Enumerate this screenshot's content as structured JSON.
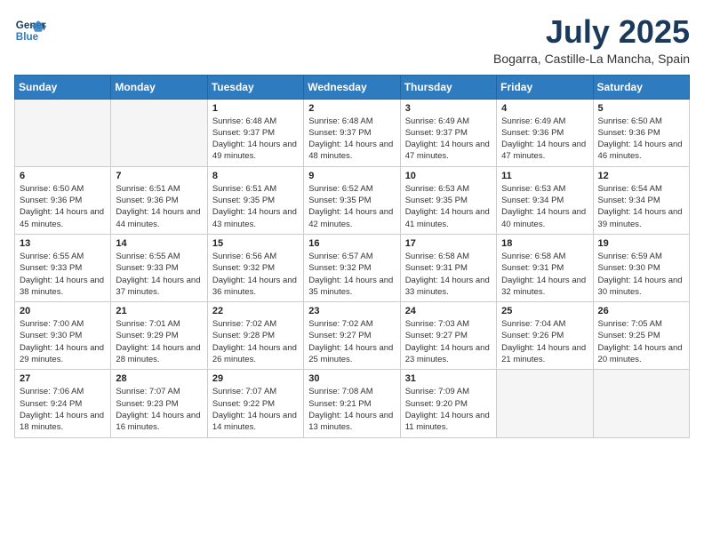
{
  "header": {
    "logo_line1": "General",
    "logo_line2": "Blue",
    "title": "July 2025",
    "subtitle": "Bogarra, Castille-La Mancha, Spain"
  },
  "columns": [
    "Sunday",
    "Monday",
    "Tuesday",
    "Wednesday",
    "Thursday",
    "Friday",
    "Saturday"
  ],
  "weeks": [
    {
      "days": [
        {
          "num": "",
          "detail": ""
        },
        {
          "num": "",
          "detail": ""
        },
        {
          "num": "1",
          "detail": "Sunrise: 6:48 AM\nSunset: 9:37 PM\nDaylight: 14 hours and 49 minutes."
        },
        {
          "num": "2",
          "detail": "Sunrise: 6:48 AM\nSunset: 9:37 PM\nDaylight: 14 hours and 48 minutes."
        },
        {
          "num": "3",
          "detail": "Sunrise: 6:49 AM\nSunset: 9:37 PM\nDaylight: 14 hours and 47 minutes."
        },
        {
          "num": "4",
          "detail": "Sunrise: 6:49 AM\nSunset: 9:36 PM\nDaylight: 14 hours and 47 minutes."
        },
        {
          "num": "5",
          "detail": "Sunrise: 6:50 AM\nSunset: 9:36 PM\nDaylight: 14 hours and 46 minutes."
        }
      ]
    },
    {
      "days": [
        {
          "num": "6",
          "detail": "Sunrise: 6:50 AM\nSunset: 9:36 PM\nDaylight: 14 hours and 45 minutes."
        },
        {
          "num": "7",
          "detail": "Sunrise: 6:51 AM\nSunset: 9:36 PM\nDaylight: 14 hours and 44 minutes."
        },
        {
          "num": "8",
          "detail": "Sunrise: 6:51 AM\nSunset: 9:35 PM\nDaylight: 14 hours and 43 minutes."
        },
        {
          "num": "9",
          "detail": "Sunrise: 6:52 AM\nSunset: 9:35 PM\nDaylight: 14 hours and 42 minutes."
        },
        {
          "num": "10",
          "detail": "Sunrise: 6:53 AM\nSunset: 9:35 PM\nDaylight: 14 hours and 41 minutes."
        },
        {
          "num": "11",
          "detail": "Sunrise: 6:53 AM\nSunset: 9:34 PM\nDaylight: 14 hours and 40 minutes."
        },
        {
          "num": "12",
          "detail": "Sunrise: 6:54 AM\nSunset: 9:34 PM\nDaylight: 14 hours and 39 minutes."
        }
      ]
    },
    {
      "days": [
        {
          "num": "13",
          "detail": "Sunrise: 6:55 AM\nSunset: 9:33 PM\nDaylight: 14 hours and 38 minutes."
        },
        {
          "num": "14",
          "detail": "Sunrise: 6:55 AM\nSunset: 9:33 PM\nDaylight: 14 hours and 37 minutes."
        },
        {
          "num": "15",
          "detail": "Sunrise: 6:56 AM\nSunset: 9:32 PM\nDaylight: 14 hours and 36 minutes."
        },
        {
          "num": "16",
          "detail": "Sunrise: 6:57 AM\nSunset: 9:32 PM\nDaylight: 14 hours and 35 minutes."
        },
        {
          "num": "17",
          "detail": "Sunrise: 6:58 AM\nSunset: 9:31 PM\nDaylight: 14 hours and 33 minutes."
        },
        {
          "num": "18",
          "detail": "Sunrise: 6:58 AM\nSunset: 9:31 PM\nDaylight: 14 hours and 32 minutes."
        },
        {
          "num": "19",
          "detail": "Sunrise: 6:59 AM\nSunset: 9:30 PM\nDaylight: 14 hours and 30 minutes."
        }
      ]
    },
    {
      "days": [
        {
          "num": "20",
          "detail": "Sunrise: 7:00 AM\nSunset: 9:30 PM\nDaylight: 14 hours and 29 minutes."
        },
        {
          "num": "21",
          "detail": "Sunrise: 7:01 AM\nSunset: 9:29 PM\nDaylight: 14 hours and 28 minutes."
        },
        {
          "num": "22",
          "detail": "Sunrise: 7:02 AM\nSunset: 9:28 PM\nDaylight: 14 hours and 26 minutes."
        },
        {
          "num": "23",
          "detail": "Sunrise: 7:02 AM\nSunset: 9:27 PM\nDaylight: 14 hours and 25 minutes."
        },
        {
          "num": "24",
          "detail": "Sunrise: 7:03 AM\nSunset: 9:27 PM\nDaylight: 14 hours and 23 minutes."
        },
        {
          "num": "25",
          "detail": "Sunrise: 7:04 AM\nSunset: 9:26 PM\nDaylight: 14 hours and 21 minutes."
        },
        {
          "num": "26",
          "detail": "Sunrise: 7:05 AM\nSunset: 9:25 PM\nDaylight: 14 hours and 20 minutes."
        }
      ]
    },
    {
      "days": [
        {
          "num": "27",
          "detail": "Sunrise: 7:06 AM\nSunset: 9:24 PM\nDaylight: 14 hours and 18 minutes."
        },
        {
          "num": "28",
          "detail": "Sunrise: 7:07 AM\nSunset: 9:23 PM\nDaylight: 14 hours and 16 minutes."
        },
        {
          "num": "29",
          "detail": "Sunrise: 7:07 AM\nSunset: 9:22 PM\nDaylight: 14 hours and 14 minutes."
        },
        {
          "num": "30",
          "detail": "Sunrise: 7:08 AM\nSunset: 9:21 PM\nDaylight: 14 hours and 13 minutes."
        },
        {
          "num": "31",
          "detail": "Sunrise: 7:09 AM\nSunset: 9:20 PM\nDaylight: 14 hours and 11 minutes."
        },
        {
          "num": "",
          "detail": ""
        },
        {
          "num": "",
          "detail": ""
        }
      ]
    }
  ]
}
